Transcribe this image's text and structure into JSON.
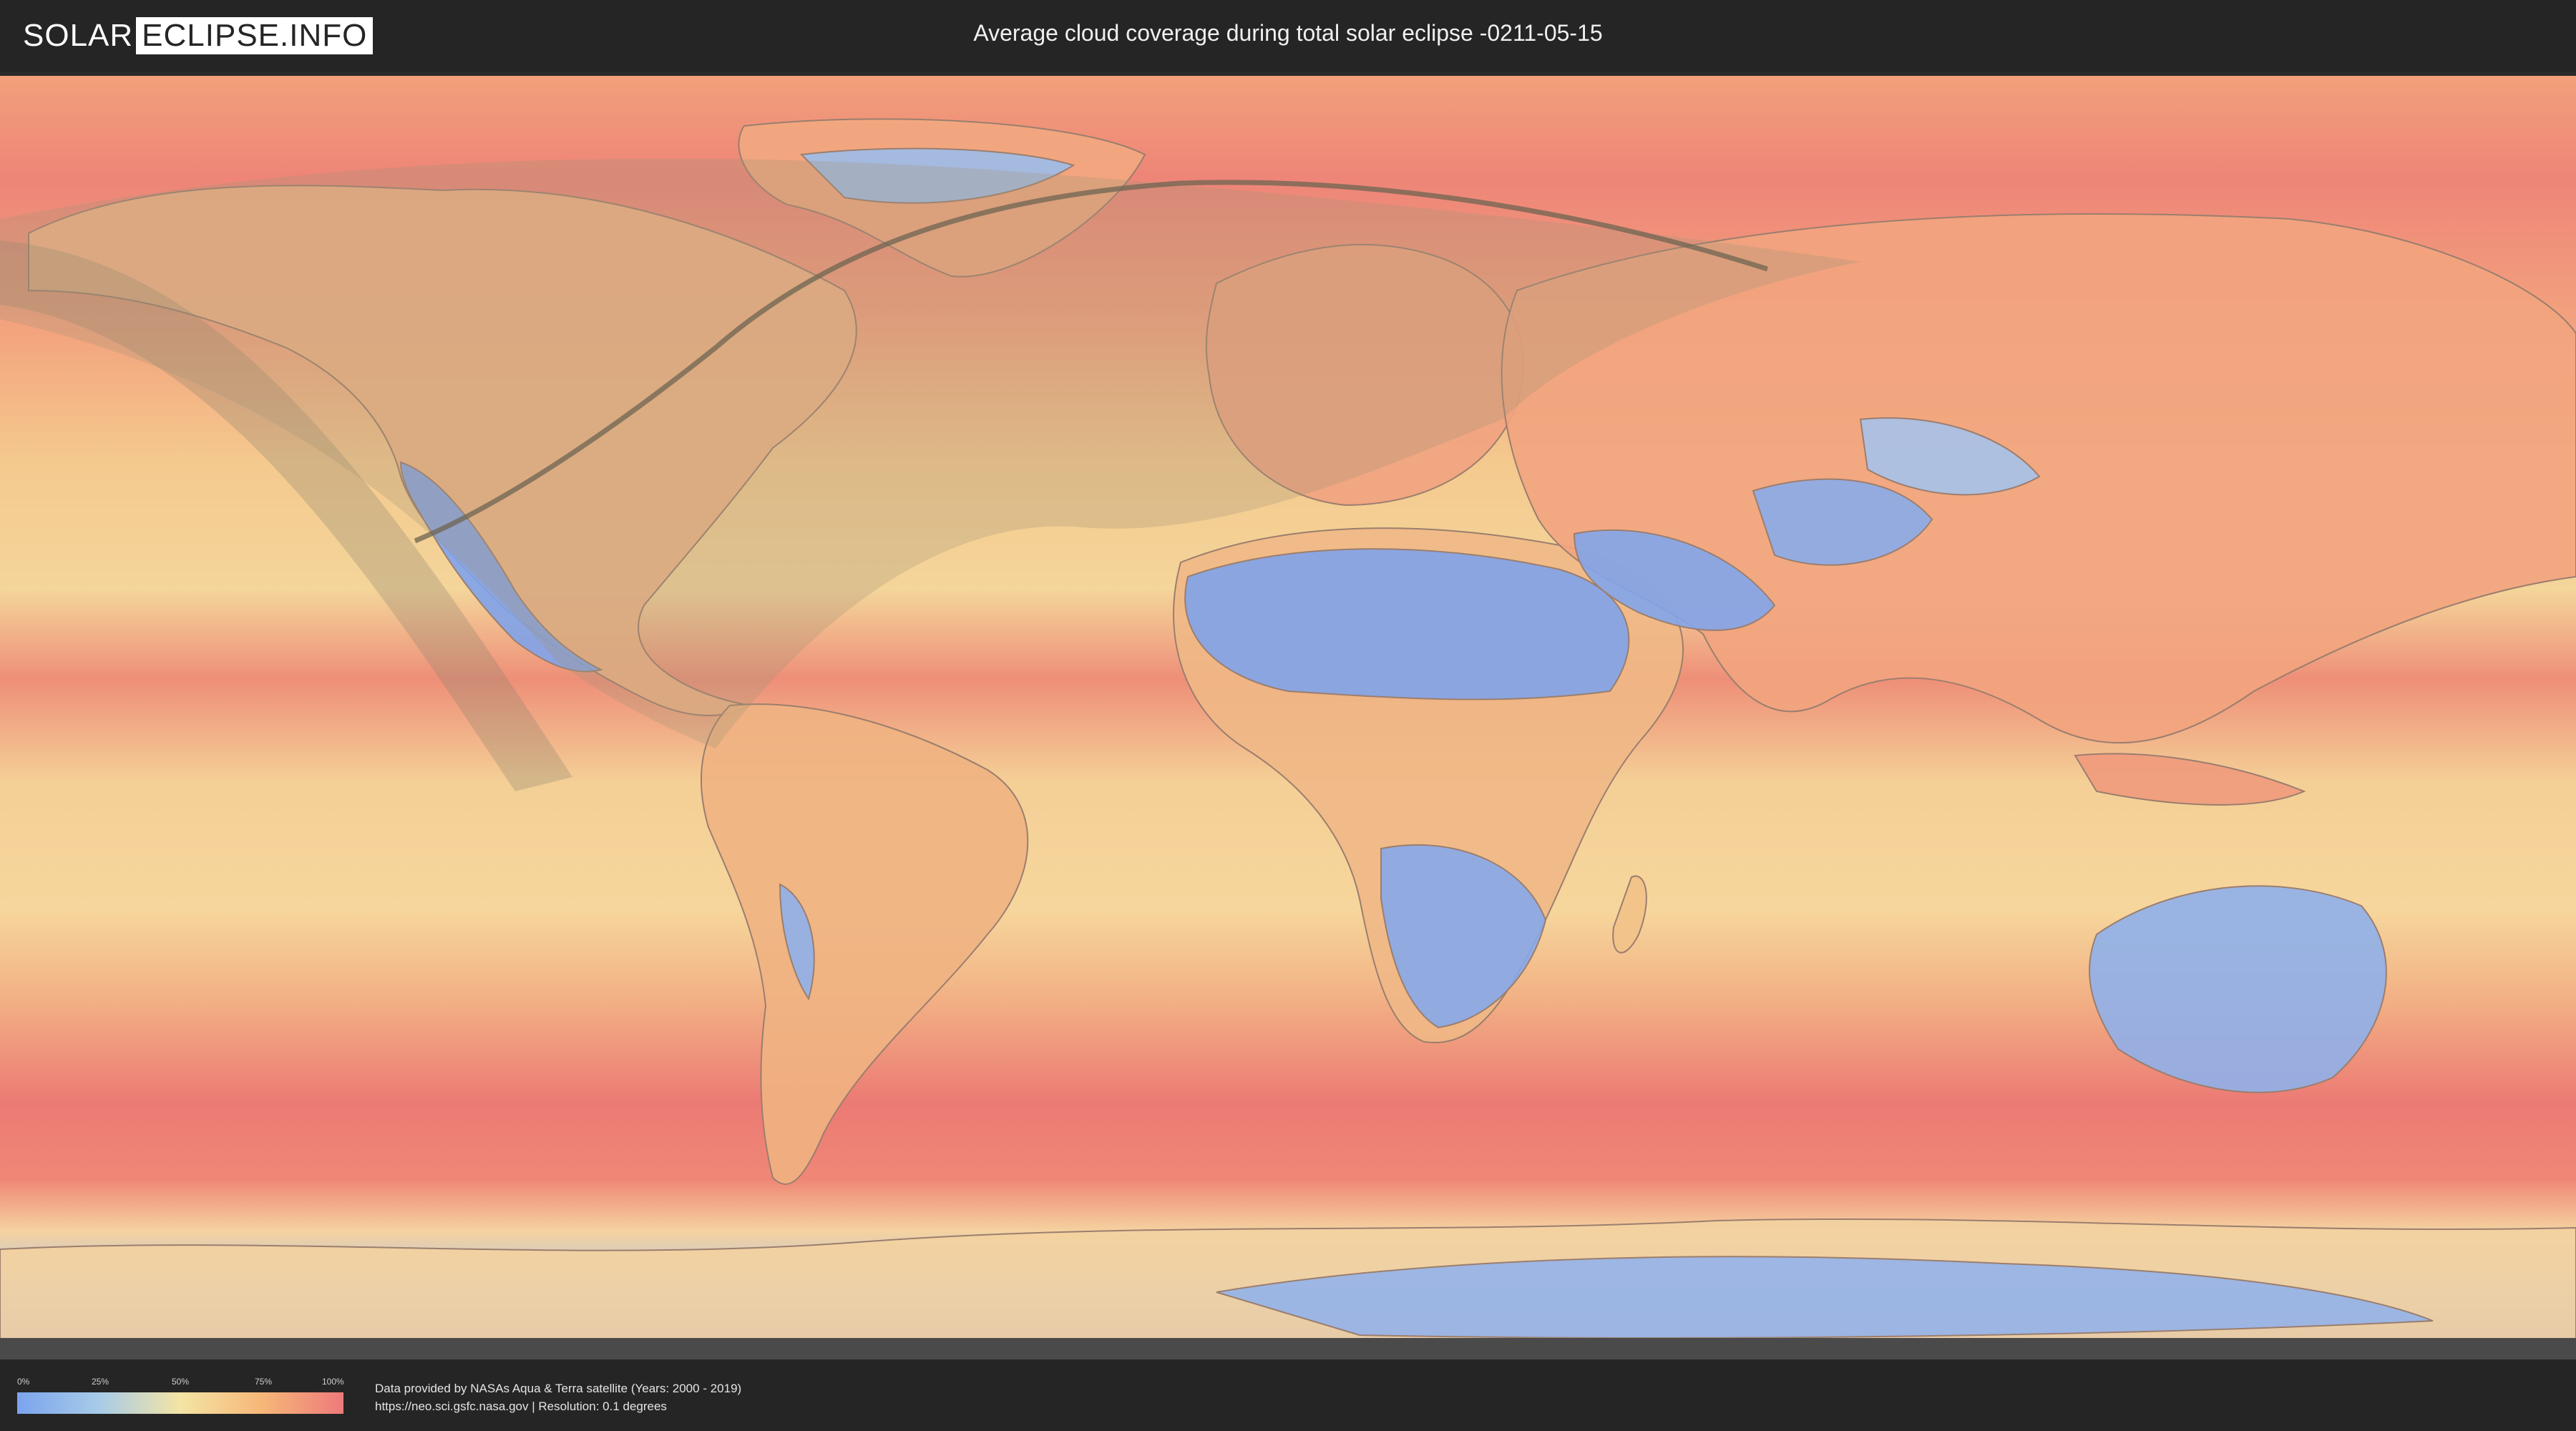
{
  "header": {
    "logo_solar": "SOLAR",
    "logo_eclipse": "ECLIPSE.INFO",
    "title": "Average cloud coverage during total solar eclipse -0211-05-15"
  },
  "legend": {
    "ticks": [
      "0%",
      "25%",
      "50%",
      "75%",
      "100%"
    ],
    "colors": [
      "#7ba4ee",
      "#a7cbe8",
      "#f4e4a4",
      "#f6b778",
      "#ee7a7a"
    ]
  },
  "footer": {
    "source_line": "Data provided by NASAs Aqua & Terra satellite (Years: 2000 - 2019)",
    "url_line": "https://neo.sci.gsfc.nasa.gov | Resolution: 0.1 degrees"
  },
  "map": {
    "projection": "equirectangular",
    "layers": [
      "cloud-coverage",
      "country-borders",
      "eclipse-visibility-zone",
      "totality-path"
    ],
    "colors": {
      "high_cloud": "#ee7a7a",
      "mid_cloud": "#f4d08c",
      "low_cloud": "#8db0ea",
      "shadow_zone": "#9a9078",
      "path_line": "#6e6452"
    }
  }
}
